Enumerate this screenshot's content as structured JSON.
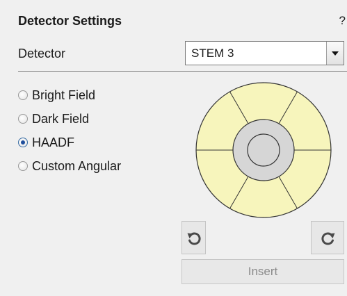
{
  "panel": {
    "title": "Detector Settings",
    "help": "?"
  },
  "detector_select": {
    "label": "Detector",
    "value": "STEM 3"
  },
  "modes": [
    {
      "label": "Bright Field",
      "checked": false
    },
    {
      "label": "Dark Field",
      "checked": false
    },
    {
      "label": "HAADF",
      "checked": true
    },
    {
      "label": "Custom Angular",
      "checked": false
    }
  ],
  "detector_diagram": {
    "outer_segments": 6,
    "segment_color": "#f7f5bc",
    "center_color": "#d6d6d6"
  },
  "buttons": {
    "rotate_ccw_icon": "rotate-counterclockwise-icon",
    "rotate_cw_icon": "rotate-clockwise-icon",
    "insert_label": "Insert",
    "insert_enabled": false
  }
}
